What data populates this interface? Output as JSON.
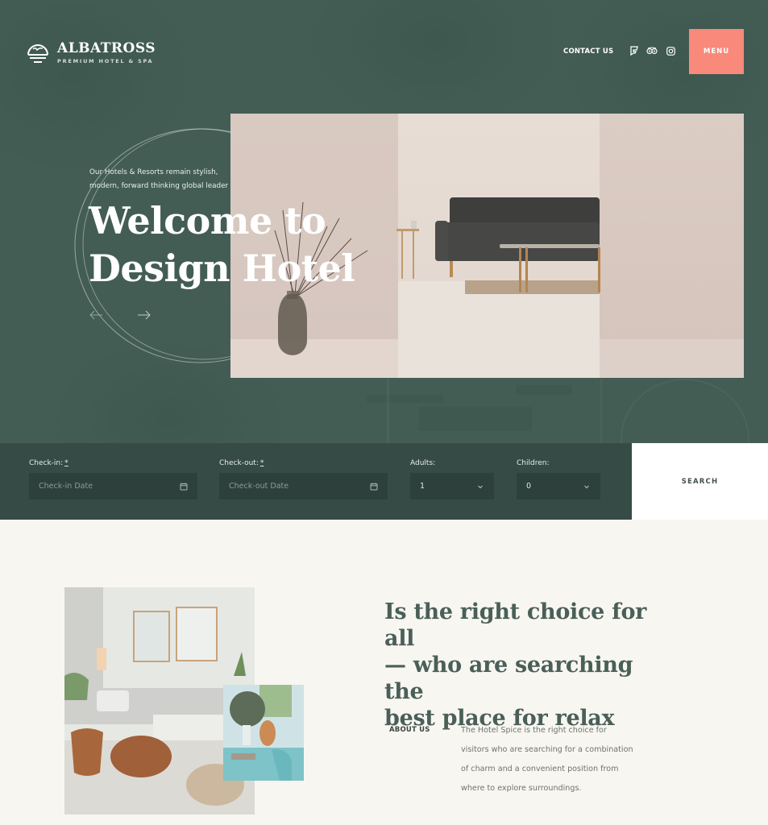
{
  "header": {
    "logo_title": "ALBATROSS",
    "logo_subtitle": "PREMIUM HOTEL & SPA",
    "contact_label": "CONTACT US",
    "social_icons": [
      "foursquare-icon",
      "tripadvisor-icon",
      "instagram-icon"
    ],
    "menu_label": "MENU"
  },
  "hero": {
    "tagline_lines": [
      "Our Hotels & Resorts remain stylish,",
      "modern, forward thinking global leader"
    ],
    "title_lines": [
      "Welcome to",
      "Design Hotel"
    ],
    "prev_arrow": "←",
    "next_arrow": "→"
  },
  "booking": {
    "checkin": {
      "label": "Check-in:",
      "required_mark": "*",
      "placeholder": "Check-in Date"
    },
    "checkout": {
      "label": "Check-out:",
      "required_mark": "*",
      "placeholder": "Check-out Date"
    },
    "adults": {
      "label": "Adults:",
      "value": "1"
    },
    "children": {
      "label": "Children:",
      "value": "0"
    },
    "search_label": "SEARCH"
  },
  "about": {
    "heading_lines": [
      "Is the right choice for all",
      "— who are searching the",
      "best place for relax"
    ],
    "label": "ABOUT US",
    "body_lines": [
      "The Hotel Spice is the right choice for",
      "visitors who are searching for a combination",
      "of charm and a convenient position from",
      "where to explore surroundings."
    ]
  },
  "colors": {
    "hero_bg": "#435d55",
    "booking_bg": "#364b45",
    "accent_menu": "#f8897b",
    "page_bg": "#f8f6f1",
    "heading_text": "#4a5f58"
  }
}
